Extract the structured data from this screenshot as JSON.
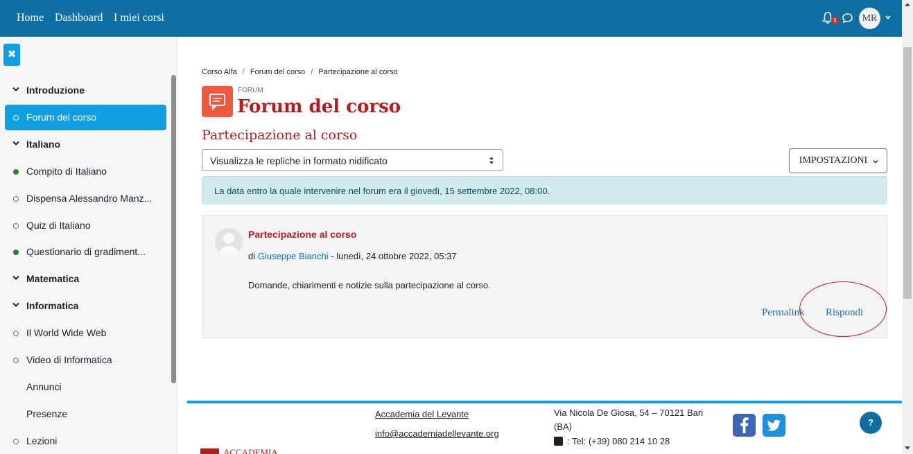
{
  "navbar": {
    "links": [
      "Home",
      "Dashboard",
      "I miei corsi"
    ],
    "notification_count": "1",
    "user_initials": "MR"
  },
  "sidebar": {
    "close_glyph": "✖",
    "items": [
      {
        "label": "Introduzione",
        "kind": "section"
      },
      {
        "label": "Forum del corso",
        "kind": "activity",
        "state": "active"
      },
      {
        "label": "Italiano",
        "kind": "section"
      },
      {
        "label": "Compito di Italiano",
        "kind": "activity",
        "state": "done"
      },
      {
        "label": "Dispensa Alessandro Manz...",
        "kind": "activity",
        "state": "open"
      },
      {
        "label": "Quiz di Italiano",
        "kind": "activity",
        "state": "open"
      },
      {
        "label": "Questionario di gradiment...",
        "kind": "activity",
        "state": "done"
      },
      {
        "label": "Matematica",
        "kind": "section"
      },
      {
        "label": "Informatica",
        "kind": "section"
      },
      {
        "label": "Il World Wide Web",
        "kind": "activity",
        "state": "open"
      },
      {
        "label": "Video di Informatica",
        "kind": "activity",
        "state": "open"
      },
      {
        "label": "Annunci",
        "kind": "activity",
        "state": "none"
      },
      {
        "label": "Presenze",
        "kind": "activity",
        "state": "none"
      },
      {
        "label": "Lezioni",
        "kind": "activity",
        "state": "open"
      }
    ]
  },
  "breadcrumb": [
    "Corso Alfa",
    "Forum del corso",
    "Partecipazione al corso"
  ],
  "forum": {
    "kicker": "FORUM",
    "title": "Forum del corso",
    "discussion_title": "Partecipazione al corso"
  },
  "controls": {
    "display_mode": "Visualizza le repliche in formato nidificato",
    "settings_label": "IMPOSTAZIONI"
  },
  "alert_text": "La data entro la quale intervenire nel forum era il giovedì, 15 settembre 2022, 08:00.",
  "post": {
    "subject": "Partecipazione al corso",
    "by_prefix": "di",
    "author": "Giuseppe Bianchi",
    "date": " - lunedì, 24 ottobre 2022, 05:37",
    "body": "Domande, chiarimenti e notizie sulla partecipazione al corso.",
    "permalink_label": "Permalink",
    "reply_label": "Rispondi"
  },
  "footer": {
    "logo_text": "ACCADEMIA",
    "org_name": "Accademia del Levante",
    "email": "info@accademiadellevante.org",
    "address": "Via Nicola De Giosa, 54 – 70121 Bari (BA)",
    "tel": ": Tel: (+39) 080 214 10 28",
    "help_glyph": "?"
  },
  "colors": {
    "navbar": "#0f6fa3",
    "accent": "#0f9fe0",
    "forum_red": "#b71c1c"
  }
}
